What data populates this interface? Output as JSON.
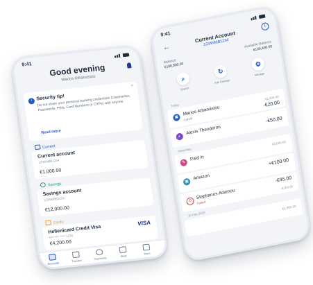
{
  "left_phone": {
    "status_time": "9:41",
    "greeting": "Good evening",
    "user_name": "Marios Athanasiou",
    "security_tip": {
      "title": "Security tip!",
      "body": "Do not share your personal banking credentials (Usernames, Passwords, PINs, Card Numbers or OTPs) with anyone.",
      "link": "Read more",
      "close": "×"
    },
    "sections": [
      {
        "label": "Current",
        "color": "#2158c7"
      },
      {
        "label": "Savings",
        "color": "#2e9e6a"
      },
      {
        "label": "Cards",
        "color": "#e6a23c"
      }
    ],
    "accounts": [
      {
        "title": "Current account",
        "number": "1234NMB1234",
        "value": "€1,000.00"
      },
      {
        "title": "Savings account",
        "number": "1234NMB1234",
        "value": "€12,000.00"
      },
      {
        "title": "Hellenicard Credit Visa",
        "number": "**** **** **** 1234",
        "value": "€4,200.00",
        "brand": "VISA"
      }
    ],
    "tabs": [
      {
        "label": "Accounts",
        "active": true
      },
      {
        "label": "Transfer",
        "active": false
      },
      {
        "label": "Payments",
        "active": false
      },
      {
        "label": "Beat",
        "active": false
      },
      {
        "label": "More",
        "active": false
      }
    ]
  },
  "right_phone": {
    "status_time": "9:41",
    "back": "←",
    "info": "i",
    "title": "Current Account",
    "iban": "1234NMB1234",
    "balance_label": "Balance",
    "balance_value": "€100,800.00",
    "available_label": "Available Balance",
    "available_value": "€100,400.00",
    "actions": [
      {
        "label": "Search",
        "glyph": "⌕"
      },
      {
        "label": "Add Savings",
        "glyph": "↻"
      },
      {
        "label": "Manage",
        "glyph": "⚙"
      }
    ],
    "transactions": [
      {
        "day": "Today",
        "name": "Marios Athanasiou",
        "sub": "Lunch",
        "amount": "-€20.00",
        "balance": "€1,000.00",
        "color": "#2158c7",
        "initial": "▣"
      },
      {
        "day": "",
        "name": "Alexis Theodorou",
        "sub": "",
        "amount": "-€50.00",
        "balance": "",
        "color": "#7a4bc9",
        "initial": "◐"
      },
      {
        "day": "Yesterday",
        "name": "Paid in",
        "sub": "",
        "amount": "",
        "balance": "€2,000.00",
        "color": "#c94b8a",
        "initial": "✎"
      },
      {
        "day": "",
        "name": "Amazon",
        "sub": "",
        "amount": "+€100.00",
        "balance": "",
        "color": "#2a8fb8",
        "initial": "▣"
      },
      {
        "day": "",
        "name": "Stephanos Adamou",
        "sub": "Failed",
        "amount": "-€45.00",
        "balance": "-€100.00",
        "color": "#d23a3a",
        "initial": "⊙"
      },
      {
        "day": "10 Feb 2020",
        "name": "",
        "sub": "",
        "amount": "",
        "balance": "€1,900.00",
        "color": "#8b97a6",
        "initial": ""
      }
    ]
  }
}
